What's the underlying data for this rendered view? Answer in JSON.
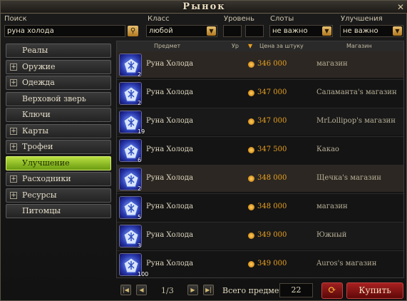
{
  "window": {
    "title": "Рынок",
    "close_icon": "✕"
  },
  "filters": {
    "search_label": "Поиск",
    "search_value": "руна холода",
    "class_label": "Класс",
    "class_value": "любой",
    "level_label": "Уровень",
    "level_min": "",
    "level_max": "",
    "slots_label": "Слоты",
    "slots_value": "не важно",
    "upgrades_label": "Улучшения",
    "upgrades_value": "не важно"
  },
  "categories": [
    {
      "label": "Реалы",
      "expandable": false,
      "active": false
    },
    {
      "label": "Оружие",
      "expandable": true,
      "active": false
    },
    {
      "label": "Одежда",
      "expandable": true,
      "active": false
    },
    {
      "label": "Верховой зверь",
      "expandable": false,
      "active": false
    },
    {
      "label": "Ключи",
      "expandable": false,
      "active": false
    },
    {
      "label": "Карты",
      "expandable": true,
      "active": false
    },
    {
      "label": "Трофеи",
      "expandable": true,
      "active": false
    },
    {
      "label": "Улучшение предметов",
      "expandable": false,
      "active": true
    },
    {
      "label": "Расходники",
      "expandable": true,
      "active": false
    },
    {
      "label": "Ресурсы",
      "expandable": true,
      "active": false
    },
    {
      "label": "Питомцы",
      "expandable": false,
      "active": false
    }
  ],
  "table": {
    "headers": {
      "item": "Предмет",
      "level": "Ур",
      "sort_icon": "▼",
      "price": "Цена за штуку",
      "seller": "Магазин"
    },
    "rows": [
      {
        "qty": "2",
        "name": "Руна Холода",
        "price": "346 000",
        "seller": "магазин"
      },
      {
        "qty": "2",
        "name": "Руна Холода",
        "price": "347 000",
        "seller": "Саламанта's магазин"
      },
      {
        "qty": "19",
        "name": "Руна Холода",
        "price": "347 000",
        "seller": "MrLollipop's магазин"
      },
      {
        "qty": "6",
        "name": "Руна Холода",
        "price": "347 500",
        "seller": "Какао"
      },
      {
        "qty": "2",
        "name": "Руна Холода",
        "price": "348 000",
        "seller": "Щечка's магазин"
      },
      {
        "qty": "5",
        "name": "Руна Холода",
        "price": "348 000",
        "seller": "магазин"
      },
      {
        "qty": "3",
        "name": "Руна Холода",
        "price": "349 000",
        "seller": "Южный"
      },
      {
        "qty": "100",
        "name": "Руна Холода",
        "price": "349 000",
        "seller": "Auros's магазин"
      }
    ]
  },
  "footer": {
    "page": "1/3",
    "total_label": "Всего предметов",
    "total_value": "22",
    "buy_label": "Купить"
  }
}
